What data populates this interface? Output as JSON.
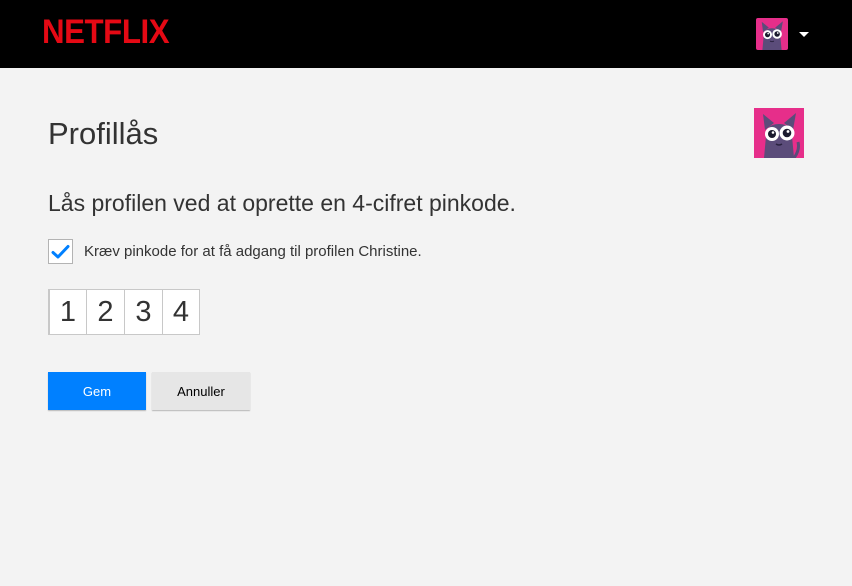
{
  "header": {
    "logo_text": "NETFLIX",
    "profile_avatar_icon": "cat-avatar-icon",
    "dropdown_icon": "caret-down-icon"
  },
  "main": {
    "title": "Profillås",
    "subtitle": "Lås profilen ved at oprette en 4-cifret pinkode.",
    "checkbox": {
      "checked": true,
      "label": "Kræv pinkode for at få adgang til profilen Christine."
    },
    "pin": [
      "1",
      "2",
      "3",
      "4"
    ],
    "buttons": {
      "save_label": "Gem",
      "cancel_label": "Annuller"
    }
  },
  "colors": {
    "brand": "#e50914",
    "primary_button": "#0080ff",
    "checkmark": "#0080ff",
    "avatar_background": "#e62e8a"
  }
}
